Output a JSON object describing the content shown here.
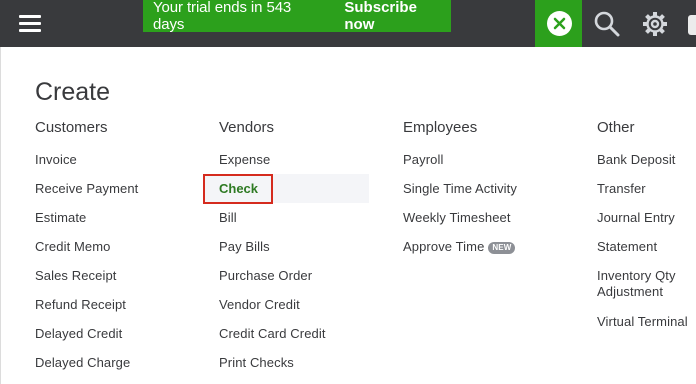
{
  "topbar": {
    "trial_text": "Your trial ends in 543 days",
    "subscribe_label": "Subscribe now"
  },
  "create": {
    "title": "Create",
    "columns": [
      {
        "header": "Customers",
        "items": [
          "Invoice",
          "Receive Payment",
          "Estimate",
          "Credit Memo",
          "Sales Receipt",
          "Refund Receipt",
          "Delayed Credit",
          "Delayed Charge"
        ]
      },
      {
        "header": "Vendors",
        "items": [
          "Expense",
          "Check",
          "Bill",
          "Pay Bills",
          "Purchase Order",
          "Vendor Credit",
          "Credit Card Credit",
          "Print Checks"
        ]
      },
      {
        "header": "Employees",
        "items": [
          "Payroll",
          "Single Time Activity",
          "Weekly Timesheet",
          "Approve Time"
        ],
        "badge": "NEW"
      },
      {
        "header": "Other",
        "items": [
          "Bank Deposit",
          "Transfer",
          "Journal Entry",
          "Statement",
          "Inventory Qty Adjustment",
          "Virtual Terminal"
        ]
      }
    ]
  },
  "colors": {
    "topbar": "#393a3d",
    "brand_green": "#2ca01c",
    "highlight_border": "#d52b1e",
    "selected_text": "#2e7a23"
  },
  "icons": [
    "hamburger-menu-icon",
    "close-icon",
    "search-icon",
    "gear-icon"
  ]
}
